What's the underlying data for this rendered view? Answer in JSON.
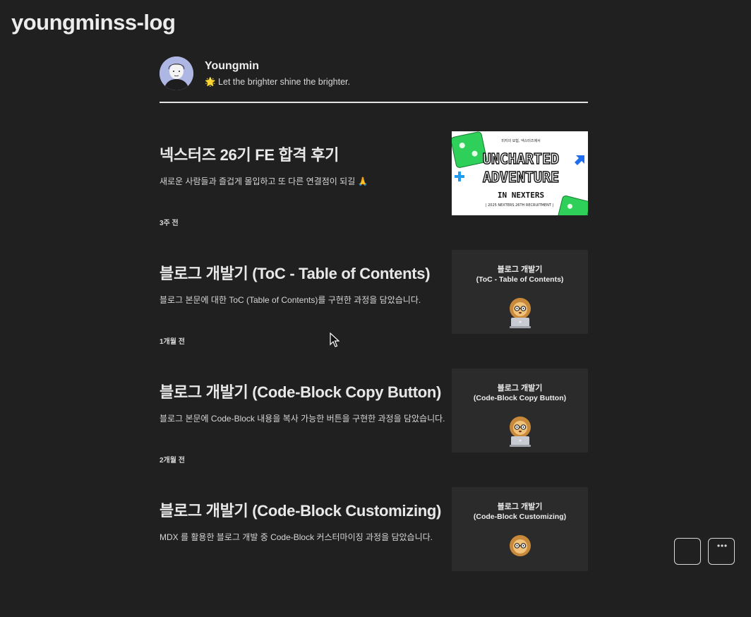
{
  "site": {
    "title": "youngminss-log"
  },
  "profile": {
    "name": "Youngmin",
    "bio": "🌟 Let the brighter shine the brighter."
  },
  "posts": [
    {
      "title": "넥스터즈 26기 FE 합격 후기",
      "description": "새로운 사람들과 즐겁게 몰입하고 또 다른 연결점이 되길 🙏",
      "date": "3주 전",
      "thumbnail": {
        "type": "nexters",
        "line1": "UNCHARTED",
        "line2": "ADVENTURE",
        "line3": "IN NEXTERS",
        "top_text": "미지의 모험, 넥스터즈에서",
        "bottom_text": "| 2025 NEXTERS 26TH RECRUITMENT |"
      }
    },
    {
      "title": "블로그 개발기 (ToC - Table of Contents)",
      "description": "블로그 본문에 대한 ToC (Table of Contents)를 구현한 과정을 담았습니다.",
      "date": "1개월 전",
      "thumbnail": {
        "type": "lion",
        "title": "블로그 개발기",
        "subtitle": "(ToC - Table of Contents)"
      }
    },
    {
      "title": "블로그 개발기 (Code-Block Copy Button)",
      "description": "블로그 본문에 Code-Block 내용을 복사 가능한 버튼을 구현한 과정을 담았습니다.",
      "date": "2개월 전",
      "thumbnail": {
        "type": "lion",
        "title": "블로그 개발기",
        "subtitle": "(Code-Block Copy Button)"
      }
    },
    {
      "title": "블로그 개발기 (Code-Block Customizing)",
      "description": "MDX 를 활용한 블로그 개발 중 Code-Block 커스터마이징 과정을 담았습니다.",
      "date": "",
      "thumbnail": {
        "type": "lion",
        "title": "블로그 개발기",
        "subtitle": "(Code-Block Customizing)"
      }
    }
  ],
  "colors": {
    "background": "#202020",
    "text": "#e8e8e8",
    "divider": "#e4e4e4",
    "thumbnail_bg": "#2b2b2b",
    "nexters_green": "#2fd05a",
    "nexters_blue": "#1f6df0"
  },
  "icons": {
    "cursor": "mouse-pointer-icon",
    "lion": "lion-with-glasses-laptop-icon",
    "avatar": "user-avatar-illustration"
  },
  "floating_buttons": [
    "scroll-top-button",
    "menu-button"
  ]
}
